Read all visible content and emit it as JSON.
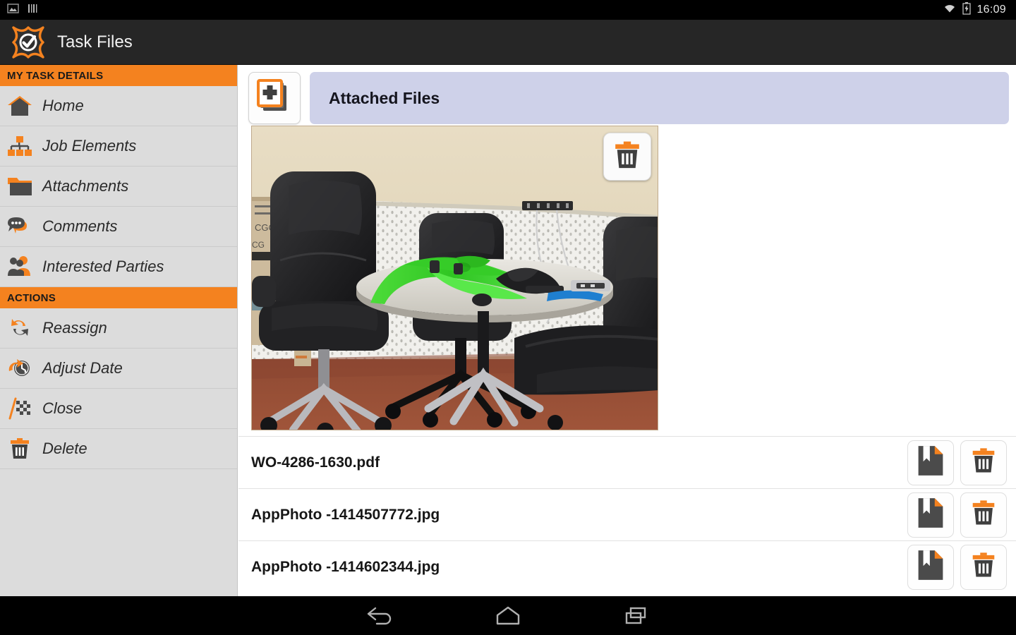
{
  "statusbar": {
    "time": "16:09",
    "icons": [
      "image-icon",
      "barcode-icon",
      "wifi-icon",
      "battery-charging-icon"
    ]
  },
  "appbar": {
    "logo": "task-check-logo",
    "title": "Task Files"
  },
  "sidebar": {
    "sections": [
      {
        "title": "MY TASK DETAILS",
        "items": [
          {
            "label": "Home",
            "icon": "home-icon"
          },
          {
            "label": "Job Elements",
            "icon": "sitemap-icon"
          },
          {
            "label": "Attachments",
            "icon": "folder-icon"
          },
          {
            "label": "Comments",
            "icon": "speech-bubble-icon"
          },
          {
            "label": "Interested Parties",
            "icon": "people-icon"
          }
        ]
      },
      {
        "title": "ACTIONS",
        "items": [
          {
            "label": "Reassign",
            "icon": "reassign-arrows-icon"
          },
          {
            "label": "Adjust Date",
            "icon": "clock-arrow-icon"
          },
          {
            "label": "Close",
            "icon": "checkered-flag-icon"
          },
          {
            "label": "Delete",
            "icon": "trash-icon"
          }
        ]
      }
    ]
  },
  "main": {
    "add_button_icon": "add-file-icon",
    "header_title": "Attached Files",
    "photo": {
      "alt": "office-chairs-table-green-harness-photo",
      "delete_icon": "trash-icon"
    },
    "files": [
      {
        "name": "WO-4286-1630.pdf",
        "open_icon": "document-bookmark-icon",
        "delete_icon": "trash-icon"
      },
      {
        "name": "AppPhoto -1414507772.jpg",
        "open_icon": "document-bookmark-icon",
        "delete_icon": "trash-icon"
      },
      {
        "name": "AppPhoto -1414602344.jpg",
        "open_icon": "document-bookmark-icon",
        "delete_icon": "trash-icon"
      }
    ]
  },
  "navbar": {
    "buttons": [
      {
        "name": "back-icon"
      },
      {
        "name": "home-icon"
      },
      {
        "name": "recent-apps-icon"
      }
    ]
  },
  "colors": {
    "accent_orange": "#F4821F",
    "sidebar_bg": "#DCDCDC",
    "header_bar": "#CED1E9",
    "dark_gray": "#3F3F3F",
    "appbar_bg": "#262626"
  }
}
